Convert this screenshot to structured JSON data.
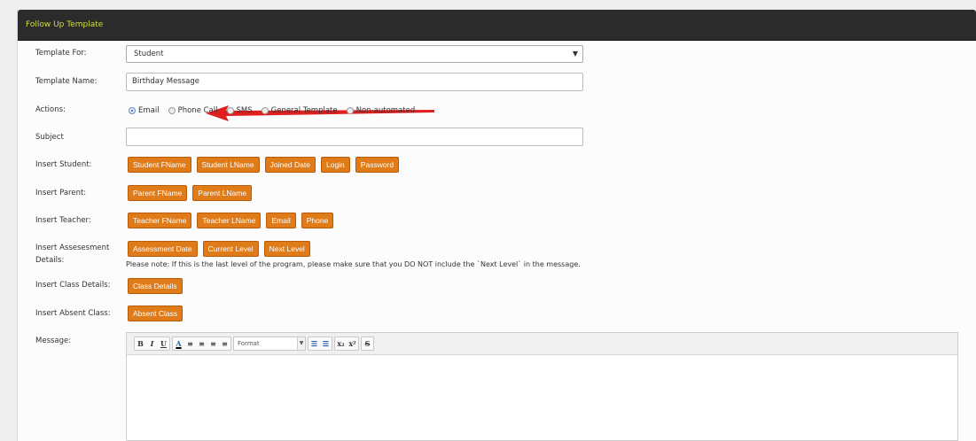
{
  "panel": {
    "title": "Follow Up Template"
  },
  "form": {
    "template_for": {
      "label": "Template For:",
      "value": "Student",
      "arrow": "▼"
    },
    "template_name": {
      "label": "Template Name:",
      "value": "Birthday Message"
    },
    "actions": {
      "label": "Actions:",
      "options": [
        {
          "label": "Email",
          "selected": true
        },
        {
          "label": "Phone Call",
          "selected": false
        },
        {
          "label": "SMS",
          "selected": false
        },
        {
          "label": "General Template",
          "selected": false
        },
        {
          "label": "Non-automated",
          "selected": false
        }
      ]
    },
    "subject": {
      "label": "Subject",
      "value": ""
    },
    "insert_student": {
      "label": "Insert Student:",
      "buttons": [
        "Student FName",
        "Student LName",
        "Joined Date",
        "Login",
        "Password"
      ]
    },
    "insert_parent": {
      "label": "Insert Parent:",
      "buttons": [
        "Parent FName",
        "Parent LName"
      ]
    },
    "insert_teacher": {
      "label": "Insert Teacher:",
      "buttons": [
        "Teacher FName",
        "Teacher LName",
        "Email",
        "Phone"
      ]
    },
    "insert_assessment": {
      "label_line1": "Insert Assesesment",
      "label_line2": "Details:",
      "buttons": [
        "Assessment Date",
        "Current Level",
        "Next Level"
      ],
      "note": "Please note: If this is the last level of the program, please make sure that you DO NOT include the `Next Level` in the message."
    },
    "insert_class": {
      "label": "Insert Class Details:",
      "buttons": [
        "Class Details"
      ]
    },
    "insert_absent": {
      "label": "Insert Absent Class:",
      "buttons": [
        "Absent Class"
      ]
    },
    "message": {
      "label": "Message:",
      "toolbar": {
        "format_label": "Format",
        "bold": "B",
        "italic": "I",
        "underline": "U",
        "font_color": "A",
        "subscript": "x₂",
        "superscript": "x²",
        "strike": "S"
      }
    }
  },
  "colors": {
    "header_bg": "#2b2b2b",
    "header_text": "#d4df3a",
    "button_bg": "#e07b1a",
    "arrow": "#e02020"
  }
}
